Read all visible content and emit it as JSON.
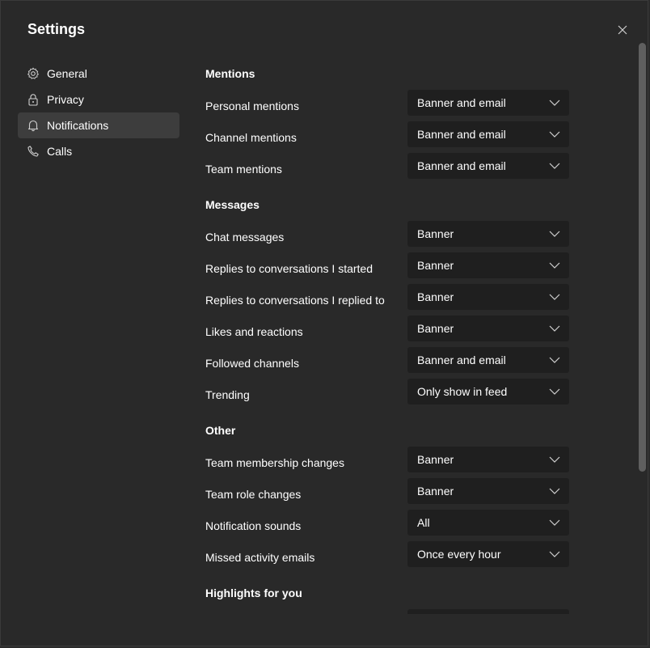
{
  "title": "Settings",
  "sidebar": {
    "items": [
      {
        "label": "General",
        "icon": "gear-icon"
      },
      {
        "label": "Privacy",
        "icon": "lock-icon"
      },
      {
        "label": "Notifications",
        "icon": "bell-icon",
        "active": true
      },
      {
        "label": "Calls",
        "icon": "phone-icon"
      }
    ]
  },
  "sections": {
    "mentions": "Mentions",
    "messages": "Messages",
    "other": "Other",
    "highlights": "Highlights for you"
  },
  "rows": {
    "personal_mentions": {
      "label": "Personal mentions",
      "value": "Banner and email"
    },
    "channel_mentions": {
      "label": "Channel mentions",
      "value": "Banner and email"
    },
    "team_mentions": {
      "label": "Team mentions",
      "value": "Banner and email"
    },
    "chat_messages": {
      "label": "Chat messages",
      "value": "Banner"
    },
    "replies_started": {
      "label": "Replies to conversations I started",
      "value": "Banner"
    },
    "replies_replied": {
      "label": "Replies to conversations I replied to",
      "value": "Banner"
    },
    "likes_reactions": {
      "label": "Likes and reactions",
      "value": "Banner"
    },
    "followed_channels": {
      "label": "Followed channels",
      "value": "Banner and email"
    },
    "trending": {
      "label": "Trending",
      "value": "Only show in feed"
    },
    "team_membership": {
      "label": "Team membership changes",
      "value": "Banner"
    },
    "team_role": {
      "label": "Team role changes",
      "value": "Banner"
    },
    "notification_sounds": {
      "label": "Notification sounds",
      "value": "All"
    },
    "missed_activity": {
      "label": "Missed activity emails",
      "value": "Once every hour"
    }
  },
  "colors": {
    "background": "#292929",
    "dropdown": "#1f1f1f",
    "active_nav": "#3d3d3d",
    "scrollbar": "#5f5f5f"
  }
}
